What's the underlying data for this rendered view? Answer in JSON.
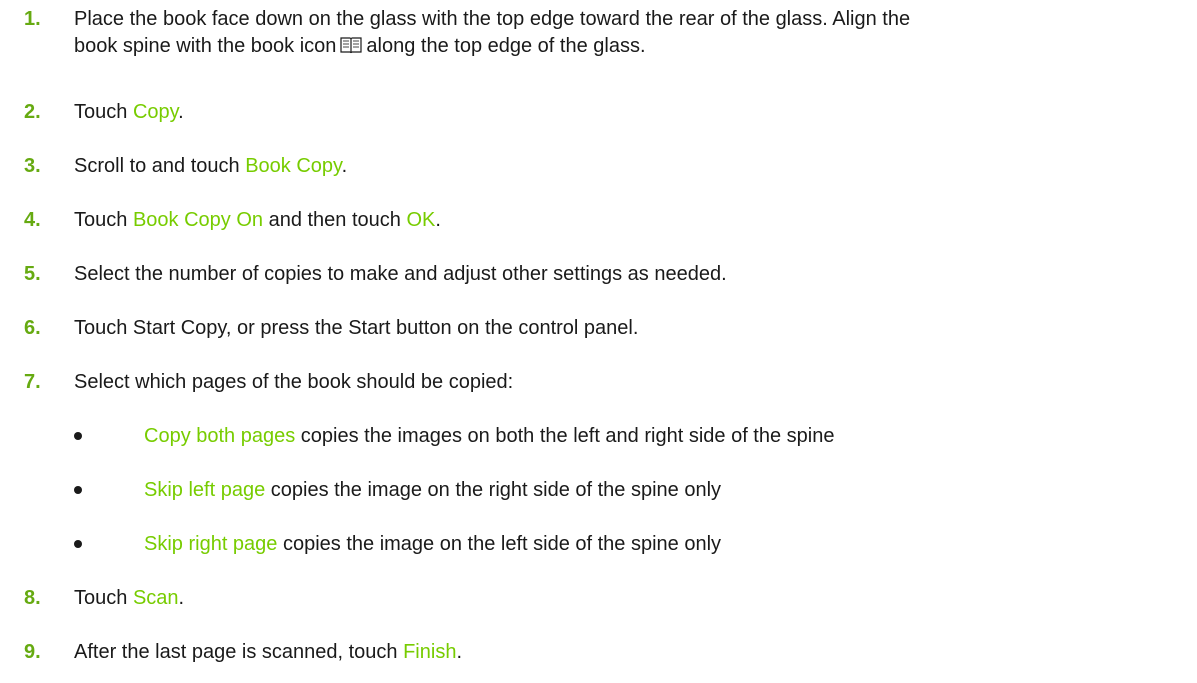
{
  "steps": [
    {
      "number": "1.",
      "line1": "Place the book face down on the glass with the top edge toward the rear of the glass. Align the",
      "line2_a": "book spine with the book icon",
      "line2_b": "along the top edge of the glass.",
      "icon": "book-icon"
    },
    {
      "number": "2.",
      "a": "Touch ",
      "b": "Copy",
      "c": "."
    },
    {
      "number": "3.",
      "a": "Scroll to and touch ",
      "b": "Book Copy",
      "c": "."
    },
    {
      "number": "4.",
      "a": "Touch ",
      "b": "Book Copy On",
      "c": " and then touch ",
      "d": "OK",
      "e": "."
    },
    {
      "number": "5.",
      "a": "Select the number of copies to make and adjust other settings as needed."
    },
    {
      "number": "6.",
      "a": "Touch Start Copy, or press the Start button on the control panel."
    },
    {
      "number": "7.",
      "a": "Select which pages of the book should be copied:",
      "bullets": [
        {
          "option": "Copy both pages",
          "desc": " copies the images on both the left and right side of the spine"
        },
        {
          "option": "Skip left page",
          "desc": " copies the image on the right side of the spine only"
        },
        {
          "option": "Skip right page",
          "desc": " copies the image on the left side of the spine only"
        }
      ]
    },
    {
      "number": "8.",
      "a": "Touch ",
      "b": "Scan",
      "c": "."
    },
    {
      "number": "9.",
      "a": "After the last page is scanned, touch ",
      "b": "Finish",
      "c": "."
    }
  ],
  "colors": {
    "step_number": "#66aa11",
    "highlight": "#77cc00",
    "text": "#1a1a1a"
  }
}
